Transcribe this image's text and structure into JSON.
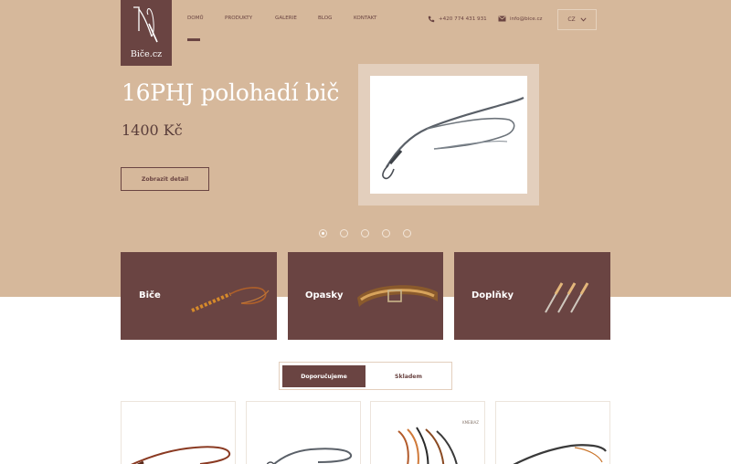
{
  "brand": {
    "logo_text": "Biče.cz"
  },
  "nav": {
    "items": [
      {
        "label": "DOMŮ"
      },
      {
        "label": "PRODUKTY"
      },
      {
        "label": "GALERIE"
      },
      {
        "label": "BLOG"
      },
      {
        "label": "KONTAKT"
      }
    ],
    "active_index": 0
  },
  "contact": {
    "phone": "+420 774 431 931",
    "email": "info@bice.cz"
  },
  "language": {
    "selected": "CZ"
  },
  "slider": {
    "title": "16PHJ polohadí bič",
    "price": "1400 Kč",
    "detail_button": "Zobrazit detail",
    "dot_count": 5,
    "active_dot": 0
  },
  "categories": [
    {
      "label": "Biče"
    },
    {
      "label": "Opasky"
    },
    {
      "label": "Doplňky"
    }
  ],
  "tabs": {
    "recommended": "Doporučujeme",
    "in_stock": "Skladem"
  },
  "products": [
    {
      "badge": ""
    },
    {
      "badge": ""
    },
    {
      "badge": "KMEBIAZ"
    },
    {
      "badge": ""
    }
  ],
  "colors": {
    "hero_background": "#d6b89b",
    "brand_dark": "#6a4442",
    "white": "#ffffff"
  },
  "icons": [
    "whip-logo-icon",
    "phone-icon",
    "mail-icon",
    "chevron-down-icon"
  ]
}
